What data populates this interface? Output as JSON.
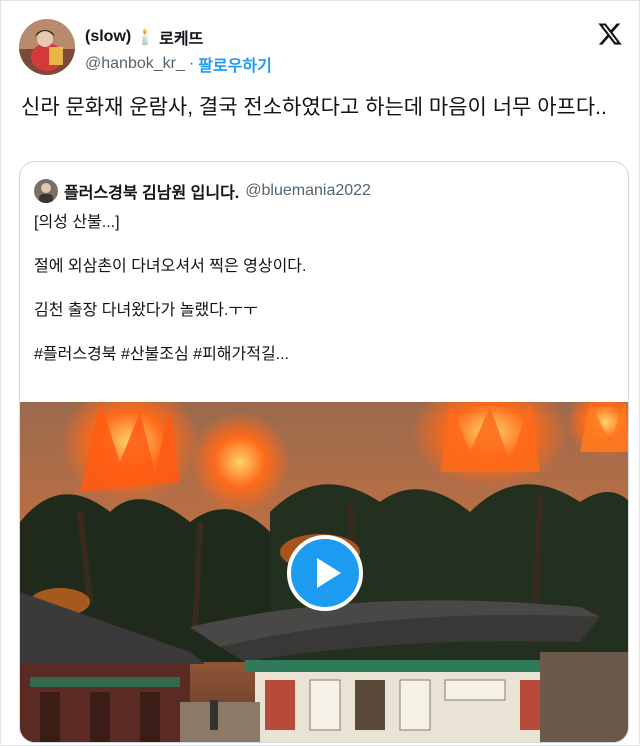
{
  "author": {
    "display_name": "(slow)",
    "emoji": "🕯️",
    "name_suffix": "로케뜨",
    "handle": "@hanbok_kr_",
    "separator": "·",
    "follow_label": "팔로우하기"
  },
  "tweet": {
    "text": "신라 문화재 운람사, 결국 전소하였다고 하는데 마음이 너무 아프다.."
  },
  "quoted": {
    "display_name": "플러스경북 김남원 입니다.",
    "handle": "@bluemania2022",
    "lines": [
      "[의성 산불...]",
      "절에 외삼촌이 다녀오셔서 찍은 영상이다.",
      "김천 출장 다녀왔다가 놀랬다.ㅜㅜ",
      "#플러스경북 #산불조심 #피해가적길..."
    ]
  },
  "icons": {
    "platform": "x-logo-icon",
    "media_control": "play-icon"
  },
  "colors": {
    "accent": "#1d9bf0",
    "text": "#0f1419",
    "secondary": "#536471"
  }
}
